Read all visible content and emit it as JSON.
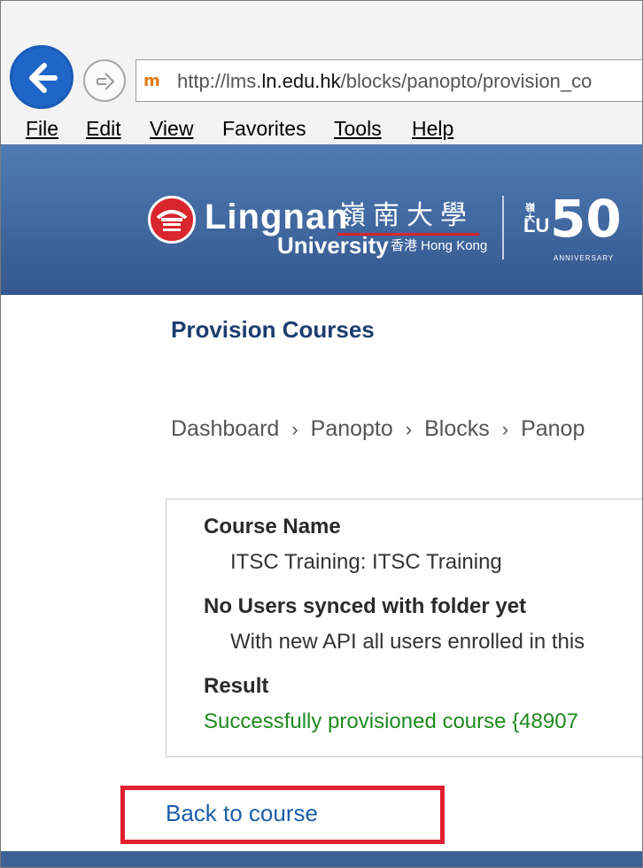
{
  "browser": {
    "url_prefix": "http://lms.",
    "url_domain": "ln.edu.hk",
    "url_suffix": "/blocks/panopto/provision_co",
    "favicon": "m",
    "menu": [
      "File",
      "Edit",
      "View",
      "Favorites",
      "Tools",
      "Help"
    ]
  },
  "banner": {
    "name_en": "Lingnan",
    "name_zh": "嶺南大學",
    "university": "University",
    "location": "香港 Hong Kong",
    "anniversary_zh": "嶺大",
    "anniversary_lu": "LU",
    "anniversary_number": "50",
    "anniversary_label": "ANNIVERSARY"
  },
  "page": {
    "title": "Provision Courses",
    "breadcrumb": [
      "Dashboard",
      "Panopto",
      "Blocks",
      "Panop"
    ]
  },
  "result_panel": {
    "course_name_label": "Course Name",
    "course_name_value": "ITSC Training: ITSC Training",
    "users_label": "No Users synced with folder yet",
    "users_value": "With new API all users enrolled in this",
    "result_label": "Result",
    "result_value": "Successfully provisioned course {48907"
  },
  "back_link": "Back to course",
  "colors": {
    "banner": "#4f7ab3",
    "title": "#1c3d6e",
    "success": "#1f8a1f",
    "link": "#1a5ea8",
    "highlight": "#e2202e"
  }
}
